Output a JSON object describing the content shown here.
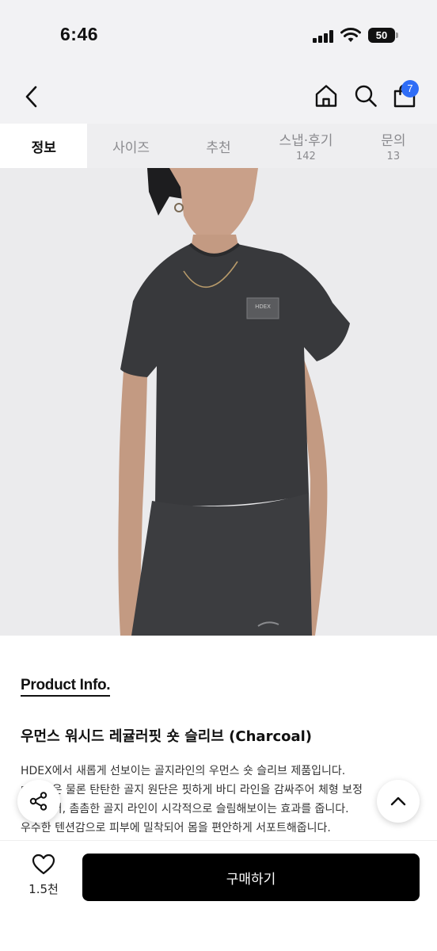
{
  "status_bar": {
    "time": "6:46",
    "battery": "50"
  },
  "header": {
    "cart_count": "7"
  },
  "tabs": [
    {
      "label": "정보",
      "count": ""
    },
    {
      "label": "사이즈",
      "count": ""
    },
    {
      "label": "추천",
      "count": ""
    },
    {
      "label": "스냅·후기",
      "count": "142"
    },
    {
      "label": "문의",
      "count": "13"
    }
  ],
  "product": {
    "image_logo_text": "HDEX",
    "section_title": "Product Info.",
    "name": "우먼스 워시드 레귤러핏 숏 슬리브 (Charcoal)",
    "description": [
      "HDEX에서 새롭게 선보이는 골지라인의 우먼스 숏 슬리브 제품입니다.",
      "□□□은 물론 탄탄한 골지 원단은 핏하게 바디 라인을 감싸주어 체형 보정",
      "□□□어, 촘촘한 골지 라인이 시각적으로 슬림해보이는 효과를 줍니다.",
      "우수한 텐션감으로 피부에 밀착되어 몸을 편안하게 서포트해줍니다."
    ]
  },
  "bottom_bar": {
    "like_count": "1.5천",
    "buy_label": "구매하기"
  },
  "colors": {
    "accent_badge": "#2f6df6",
    "buy_button": "#000000",
    "header_bg": "#f2f2f4"
  }
}
